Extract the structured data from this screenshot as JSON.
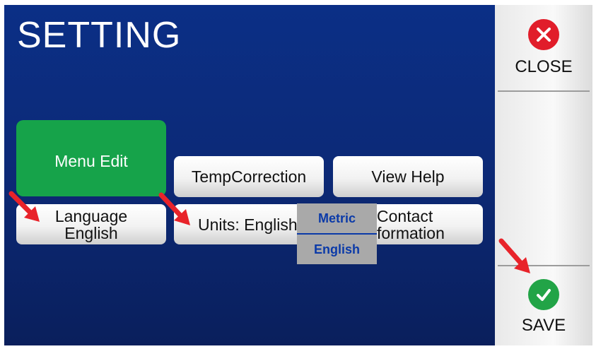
{
  "title": "SETTING",
  "buttons": {
    "menu_edit": "Menu Edit",
    "temp_correction": "TempCorrection",
    "view_help": "View Help",
    "language_line1": "Language",
    "language_line2": "English",
    "units": "Units: English",
    "contact_line1": "Contact",
    "contact_line2": "formation"
  },
  "units_dropdown": {
    "options": [
      "Metric",
      "English"
    ]
  },
  "side": {
    "close_label": "CLOSE",
    "save_label": "SAVE"
  },
  "colors": {
    "screen_bg": "#0c2a78",
    "menu_edit_green": "#16a34a",
    "close_red": "#e11d2a",
    "save_green": "#22a447",
    "annotation_arrow": "#e8232a",
    "dropdown_text": "#0b3aa8"
  },
  "icons": [
    "close-icon",
    "save-check-icon",
    "annotation-arrow"
  ]
}
